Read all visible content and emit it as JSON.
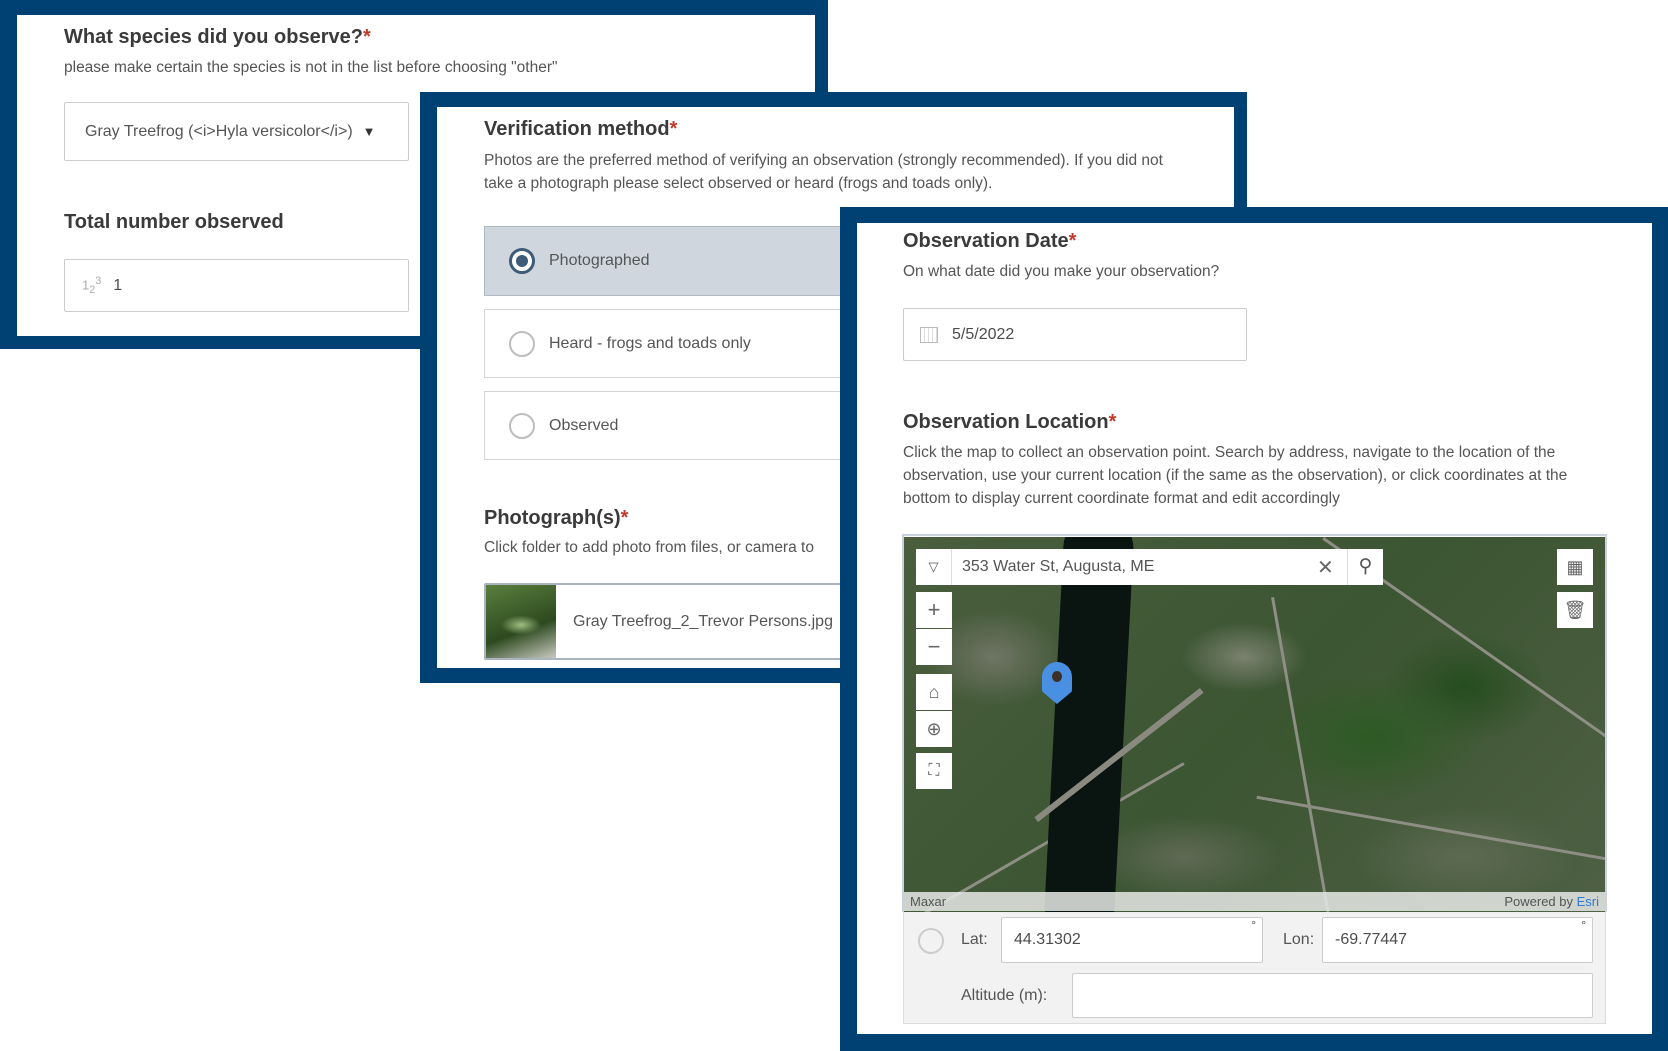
{
  "panel_species": {
    "title": "What species did you observe?",
    "required_mark": "*",
    "hint": "please make certain the species is not in the list before choosing \"other\"",
    "species_value": "Gray Treefrog (<i>Hyla versicolor</i>)",
    "dropdown_icon": "triangle-down",
    "count_label": "Total number observed",
    "count_icon": "number-123",
    "count_value": "1"
  },
  "panel_verification": {
    "title": "Verification method",
    "required_mark": "*",
    "hint": "Photos are the preferred method of verifying an observation (strongly recommended). If you did not take a photograph please select observed or heard (frogs and toads only).",
    "options": [
      {
        "label": "Photographed",
        "selected": true
      },
      {
        "label": "Heard - frogs and toads only",
        "selected": false
      },
      {
        "label": "Observed",
        "selected": false
      }
    ],
    "photo_title": "Photograph(s)",
    "photo_hint": "Click folder to add photo from files, or camera to",
    "photo_file": "Gray Treefrog_2_Trevor Persons.jpg"
  },
  "panel_location": {
    "date_title": "Observation Date",
    "required_mark": "*",
    "date_hint": "On what date did you make your observation?",
    "date_value": "5/5/2022",
    "location_title": "Observation Location",
    "location_hint": "Click the map to collect an observation point. Search by address, navigate to the location of the observation, use your current location (if the same as the observation), or click coordinates at the bottom to display current coordinate format and edit accordingly",
    "search_value": "353 Water St, Augusta, ME",
    "attribution_left": "Maxar",
    "attribution_powered": "Powered by ",
    "attribution_esri": "Esri",
    "lat_label": "Lat:",
    "lat_value": "44.31302",
    "lon_label": "Lon:",
    "lon_value": "-69.77447",
    "degree_symbol": "°",
    "altitude_label": "Altitude (m):",
    "altitude_value": ""
  },
  "colors": {
    "frame": "#004174",
    "required": "#c0392b",
    "pin": "#4a90e2",
    "esri_link": "#2f7bd3"
  }
}
